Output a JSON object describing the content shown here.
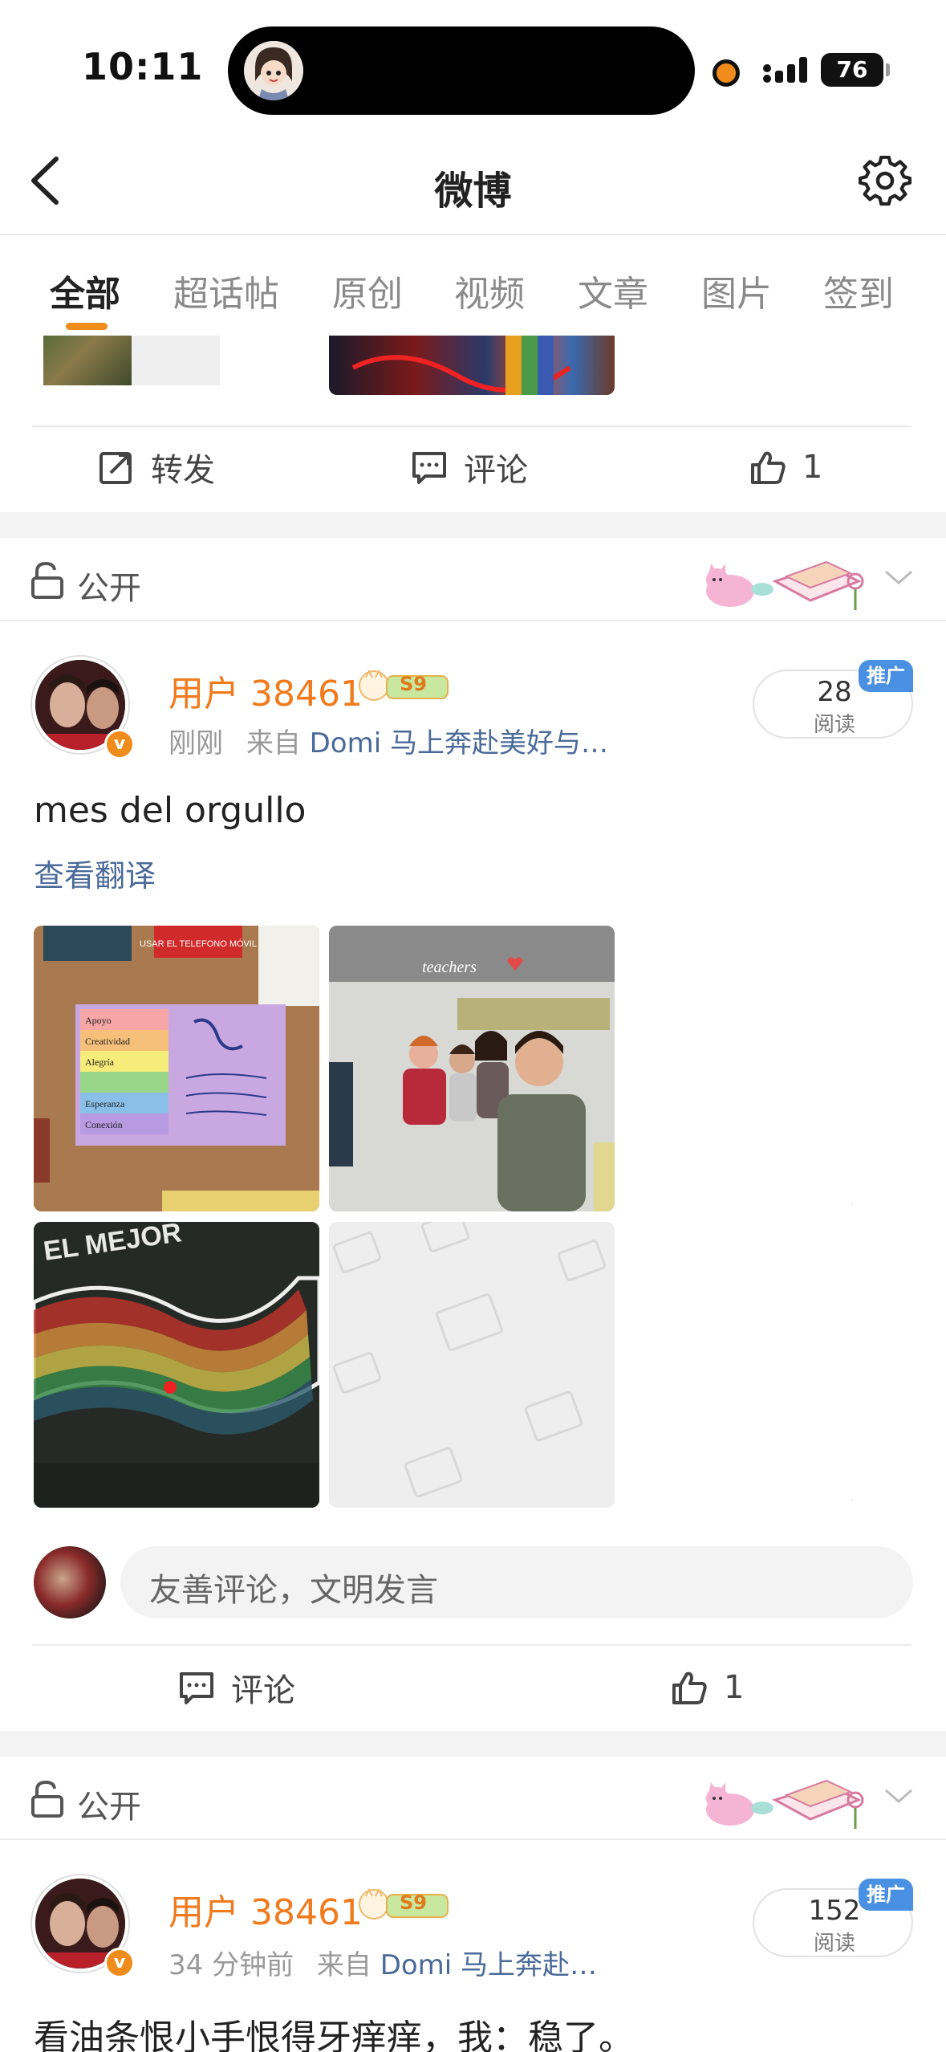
{
  "status_bar": {
    "time": "10:11",
    "battery": "76"
  },
  "nav": {
    "title": "微博"
  },
  "tabs": [
    {
      "label": "全部",
      "active": true
    },
    {
      "label": "超话帖"
    },
    {
      "label": "原创"
    },
    {
      "label": "视频"
    },
    {
      "label": "文章"
    },
    {
      "label": "图片"
    },
    {
      "label": "签到"
    }
  ],
  "prev_post": {
    "repost_label": "转发",
    "comment_label": "评论",
    "like_count": "1"
  },
  "post1": {
    "visibility": "公开",
    "username": "用户 38461",
    "level": "S9",
    "time": "刚刚",
    "source_prefix": "来自",
    "source": "Domi 马上奔赴美好与…",
    "read_count": "28",
    "read_label": "阅读",
    "promo_tag": "推广",
    "text": "mes del orgullo",
    "translate": "查看翻译",
    "photo_board_text": {
      "sign": "USAR EL TELEFONO MÓVIL",
      "line1": "Apoyo",
      "line2": "Creatividad",
      "line3": "Alegría",
      "line4": "Esperanza",
      "line5": "Conexión"
    },
    "photo_teachers_caption": "teachers",
    "photo_chalk_text": "EL MEJOR",
    "comment_placeholder": "友善评论，文明发言",
    "comment_label": "评论",
    "like_count": "1"
  },
  "post2": {
    "visibility": "公开",
    "username": "用户 38461",
    "level": "S9",
    "time": "34 分钟前",
    "source_prefix": "来自",
    "source": "Domi 马上奔赴…",
    "read_count": "152",
    "read_label": "阅读",
    "promo_tag": "推广",
    "text": "看油条恨小手恨得牙痒痒，我：稳了。"
  },
  "colors": {
    "accent": "#f08c1c",
    "link": "#4a6a9a",
    "promo": "#4a90e2"
  }
}
